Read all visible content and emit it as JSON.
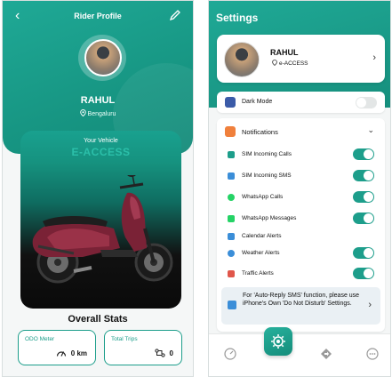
{
  "profile_screen": {
    "title": "Rider Profile",
    "name": "RAHUL",
    "location": "Bengaluru",
    "vehicle_label": "Your Vehicle",
    "vehicle_model": "E-ACCESS",
    "stats_title": "Overall Stats",
    "stats": {
      "odo_label": "ODO Meter",
      "odo_value": "0 km",
      "trips_label": "Total Trips",
      "trips_value": "0"
    }
  },
  "settings_screen": {
    "title": "Settings",
    "profile": {
      "name": "RAHUL",
      "model": "e-ACCESS"
    },
    "dark_mode": {
      "label": "Dark Mode",
      "enabled": false
    },
    "notifications": {
      "label": "Notifications",
      "items": [
        {
          "label": "SIM Incoming Calls",
          "icon": "phone-icon",
          "color": "#1d9e8b",
          "enabled": true
        },
        {
          "label": "SIM Incoming SMS",
          "icon": "sms-icon",
          "color": "#3b8ed8",
          "enabled": true
        },
        {
          "label": "WhatsApp Calls",
          "icon": "whatsapp-icon",
          "color": "#25d366",
          "enabled": true
        },
        {
          "label": "WhatsApp Messages",
          "icon": "whatsapp-message-icon",
          "color": "#25d366",
          "enabled": true
        },
        {
          "label": "Calendar Alerts",
          "icon": "calendar-icon",
          "color": "#3b8ed8",
          "enabled": null
        },
        {
          "label": "Weather Alerts",
          "icon": "weather-icon",
          "color": "#3b8ed8",
          "enabled": true
        },
        {
          "label": "Traffic Alerts",
          "icon": "traffic-icon",
          "color": "#e0564a",
          "enabled": true
        }
      ],
      "info": "For 'Auto-Reply SMS' function, please use iPhone's Own 'Do Not Disturb' Settings."
    },
    "nav": [
      "speedometer-icon",
      "settings-icon",
      "navigation-icon",
      "more-icon"
    ]
  },
  "colors": {
    "brand_teal": "#1d9e8b",
    "toggle_off": "#e3e6e6"
  }
}
